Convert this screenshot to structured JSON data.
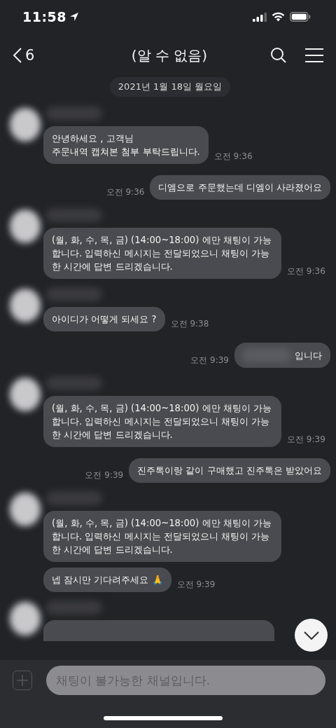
{
  "status_bar": {
    "time": "11:58"
  },
  "header": {
    "back_count": "6",
    "title": "(알 수 없음)"
  },
  "date_divider": "2021년 1월 18일 월요일",
  "messages": [
    {
      "kind": "received",
      "text": "안녕하세요 , 고객님\n주문내역 캡쳐본 첨부 부탁드립니다.",
      "time": "오전 9:36"
    },
    {
      "kind": "sent",
      "text": "디엠으로 주문했는데 디엠이 사라졌어요",
      "time": "오전 9:36"
    },
    {
      "kind": "received",
      "text": "(월, 화, 수, 목, 금) (14:00~18:00) 에만 채팅이 가능합니다. 입력하신 메시지는 전달되었으니 채팅이 가능한 시간에 답변 드리겠습니다.",
      "time": "오전 9:36"
    },
    {
      "kind": "received",
      "text": "아이디가 어떻게 되세요 ?",
      "time": "오전 9:38"
    },
    {
      "kind": "sent",
      "redacted": true,
      "text": "입니다",
      "time": "오전 9:39"
    },
    {
      "kind": "received",
      "text": "(월, 화, 수, 목, 금) (14:00~18:00) 에만 채팅이 가능합니다. 입력하신 메시지는 전달되었으니 채팅이 가능한 시간에 답변 드리겠습니다.",
      "time": "오전 9:39"
    },
    {
      "kind": "sent",
      "text": "진주톡이랑 같이 구매했고 진주톡은 받았어요",
      "time": "오전 9:39"
    },
    {
      "kind": "received",
      "text": "(월, 화, 수, 목, 금) (14:00~18:00) 에만 채팅이 가능합니다. 입력하신 메시지는 전달되었으니 채팅이 가능한 시간에 답변 드리겠습니다."
    },
    {
      "kind": "received_followup",
      "text": "넵 잠시만 기다려주세요 🙏",
      "time": "오전 9:39"
    },
    {
      "kind": "received_cut"
    }
  ],
  "composer": {
    "placeholder": "채팅이 불가능한 채널입니다."
  }
}
